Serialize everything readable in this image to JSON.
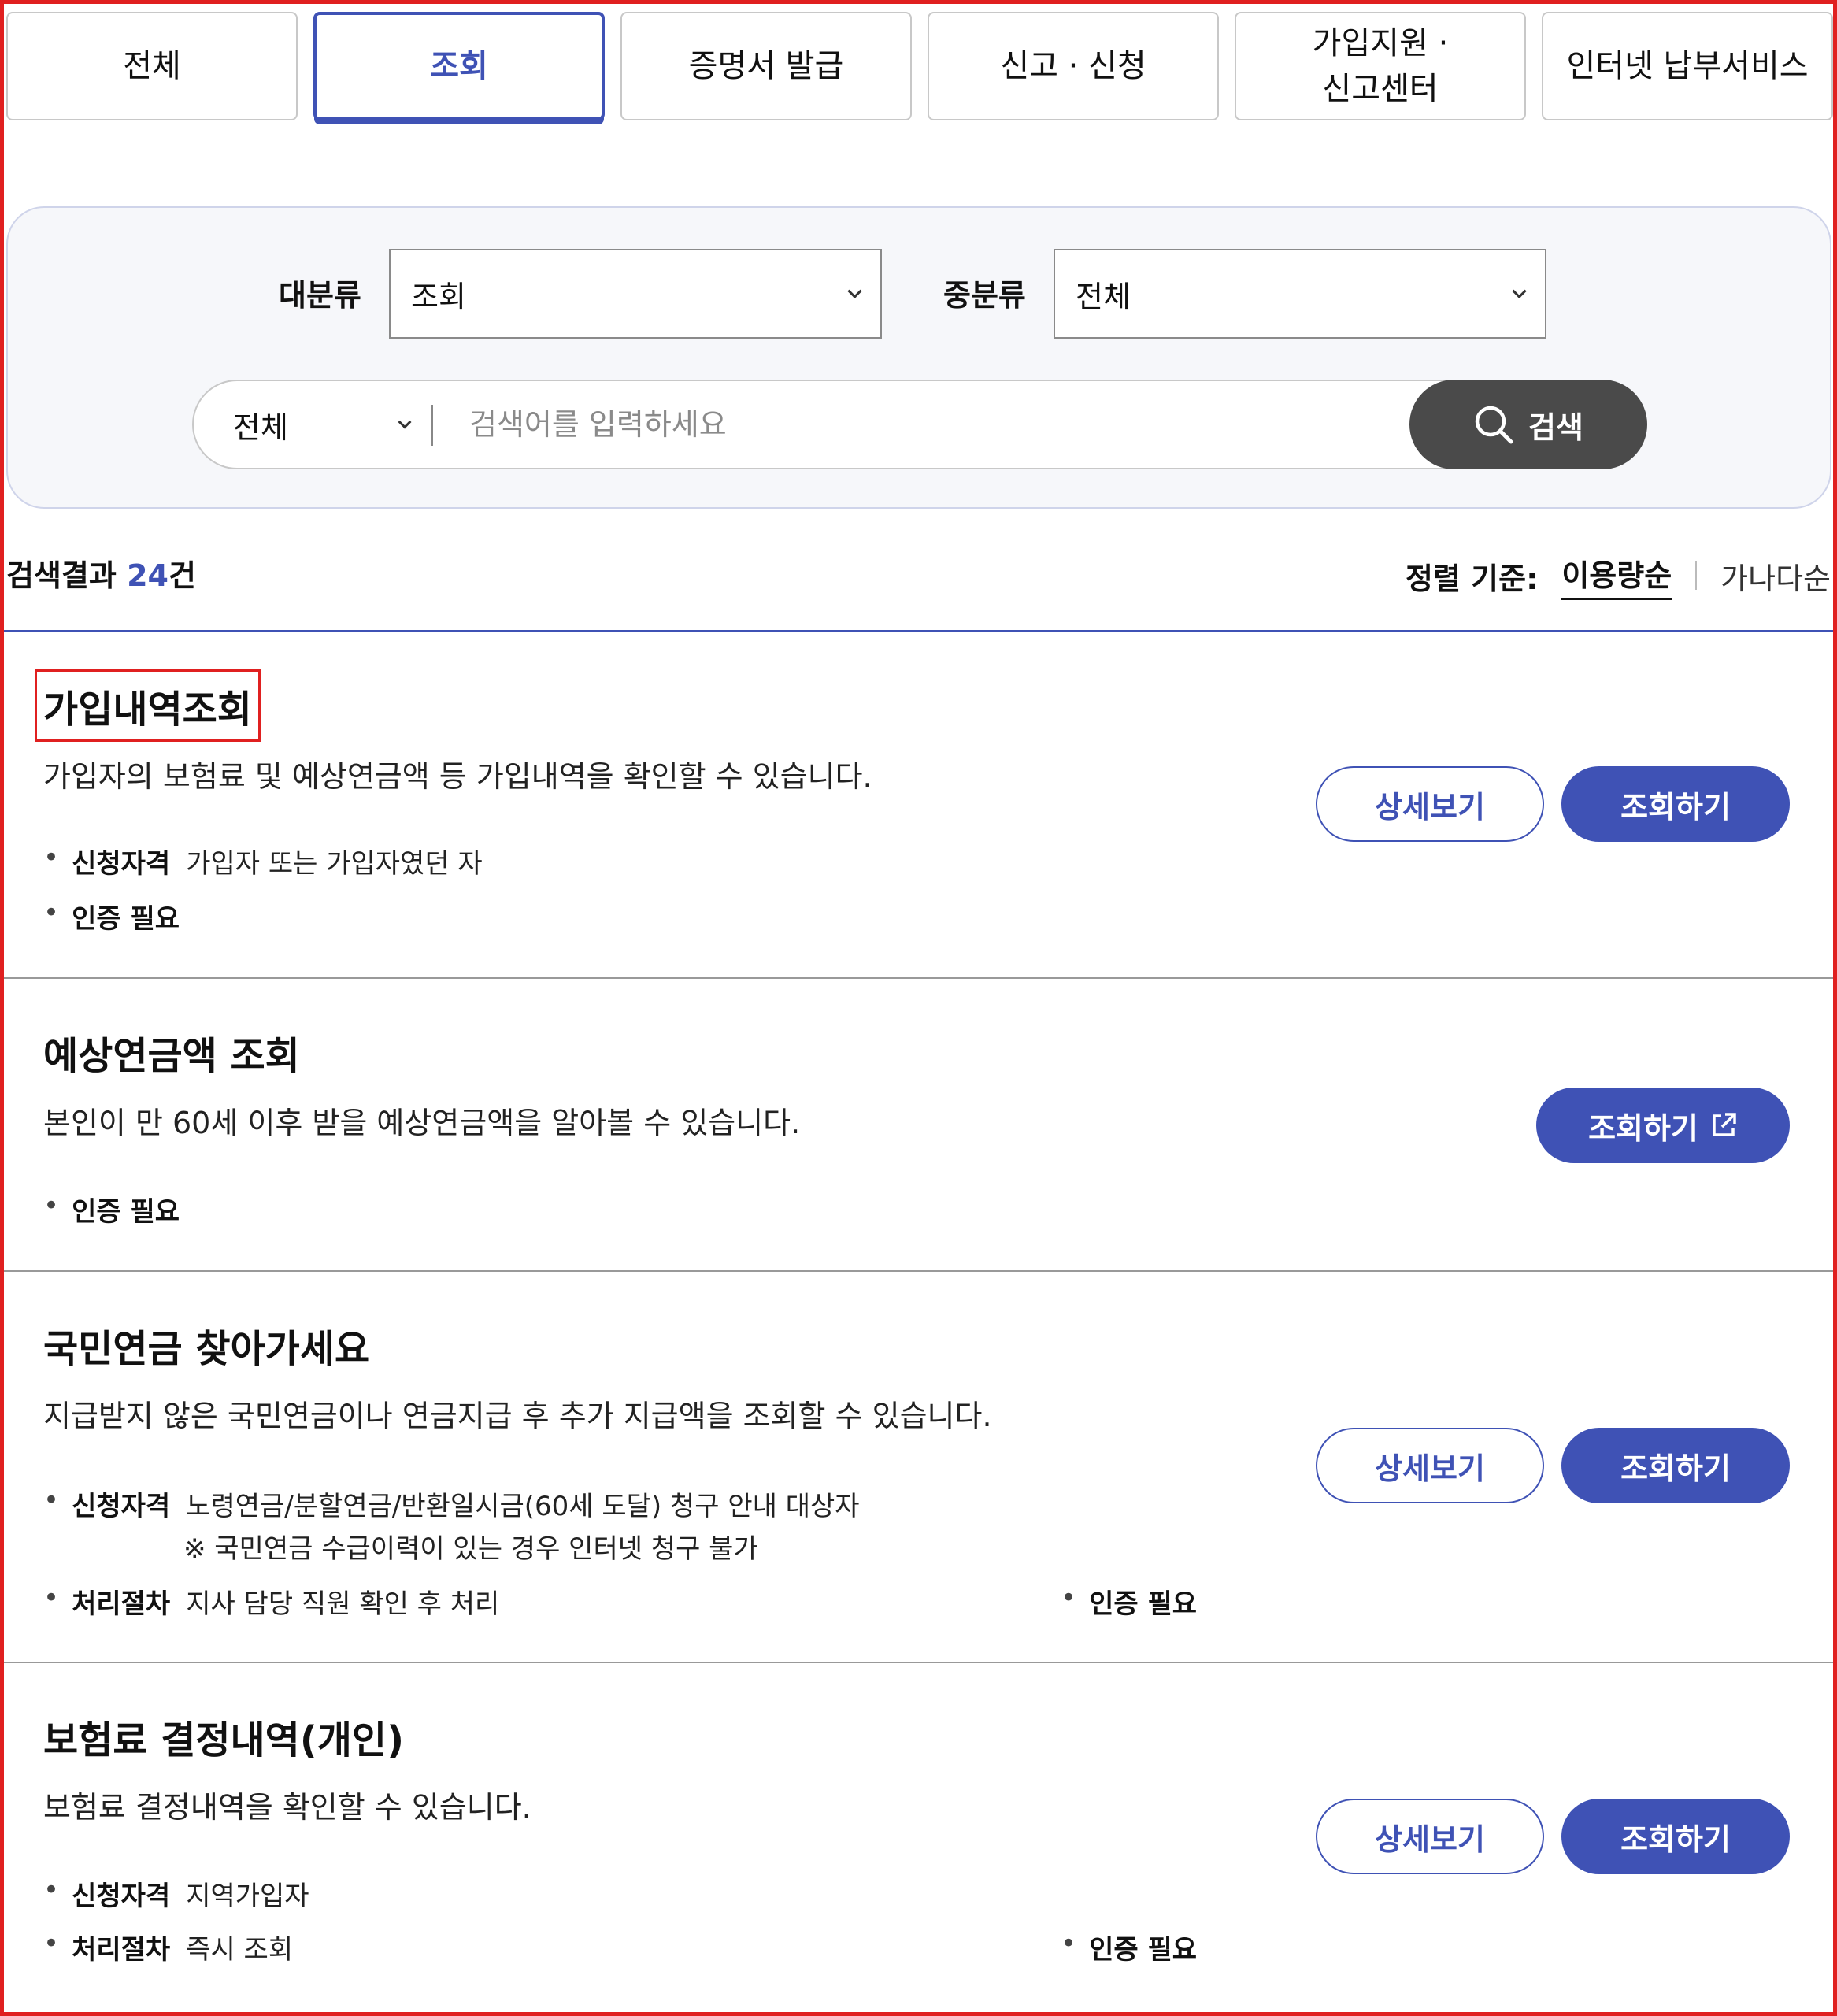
{
  "tabs": [
    {
      "label": "전체",
      "active": false
    },
    {
      "label": "조회",
      "active": true
    },
    {
      "label": "증명서 발급",
      "active": false
    },
    {
      "label": "신고 · 신청",
      "active": false
    },
    {
      "label": "가입지원 ·\n신고센터",
      "active": false
    },
    {
      "label": "인터넷 납부서비스",
      "active": false
    }
  ],
  "filters": {
    "major_label": "대분류",
    "major_value": "조회",
    "minor_label": "중분류",
    "minor_value": "전체",
    "scope_value": "전체",
    "search_placeholder": "검색어를 입력하세요",
    "search_button": "검색"
  },
  "results": {
    "prefix": "검색결과 ",
    "count": "24",
    "suffix": "건",
    "sort_label": "정렬 기준:",
    "sort_active": "이용량순",
    "sort_other": "가나다순"
  },
  "items": [
    {
      "title": "가입내역조회",
      "desc": "가입자의 보험료 및 예상연금액 등 가입내역을 확인할 수 있습니다.",
      "elig_key": "신청자격",
      "elig_val": "가입자 또는 가입자였던 자",
      "auth": "인증 필요",
      "detail_btn": "상세보기",
      "query_btn": "조회하기"
    },
    {
      "title": "예상연금액 조회",
      "desc": "본인이 만 60세 이후 받을 예상연금액을 알아볼 수 있습니다.",
      "auth": "인증 필요",
      "query_btn": "조회하기"
    },
    {
      "title": "국민연금 찾아가세요",
      "desc": "지급받지 않은 국민연금이나 연금지급 후 추가 지급액을 조회할 수 있습니다.",
      "elig_key": "신청자격",
      "elig_val": "노령연금/분할연금/반환일시금(60세 도달) 청구 안내 대상자",
      "note": "※ 국민연금 수급이력이 있는 경우 인터넷 청구 불가",
      "proc_key": "처리절차",
      "proc_val": "지사 담당 직원 확인 후 처리",
      "auth": "인증 필요",
      "detail_btn": "상세보기",
      "query_btn": "조회하기"
    },
    {
      "title": "보험료 결정내역(개인)",
      "desc": "보험료 결정내역을 확인할 수 있습니다.",
      "elig_key": "신청자격",
      "elig_val": "지역가입자",
      "proc_key": "처리절차",
      "proc_val": "즉시 조회",
      "auth": "인증 필요",
      "detail_btn": "상세보기",
      "query_btn": "조회하기"
    }
  ],
  "colors": {
    "accent": "#3f52b5",
    "search_button": "#4a4a4a",
    "highlight": "#e02020"
  }
}
